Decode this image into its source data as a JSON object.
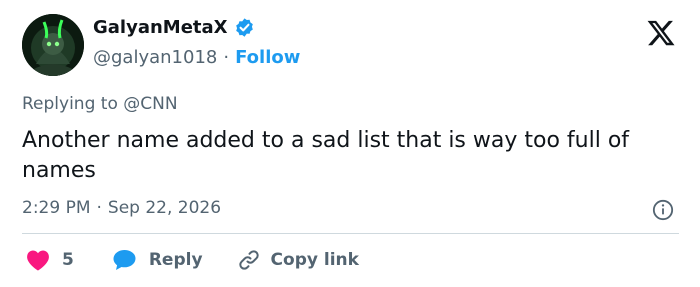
{
  "author": {
    "display_name": "GalyanMetaX",
    "handle": "@galyan1018",
    "separator": "·",
    "follow_label": "Follow",
    "verified": true
  },
  "reply_to": {
    "prefix": "Replying to",
    "mention": "@CNN"
  },
  "tweet": {
    "text": "Another name added to a sad list that is way too full of names",
    "time": "2:29 PM",
    "separator": "·",
    "date": "Sep 22, 2026"
  },
  "actions": {
    "likes_count": "5",
    "reply_label": "Reply",
    "copy_link_label": "Copy link"
  },
  "colors": {
    "accent": "#1d9bf0",
    "like": "#f91880",
    "muted_text": "#536471",
    "text": "#0f1419",
    "divider": "#cfd9de"
  },
  "icons": [
    "verified-badge-icon",
    "x-logo-icon",
    "info-icon",
    "heart-icon",
    "reply-bubble-icon",
    "link-icon"
  ]
}
